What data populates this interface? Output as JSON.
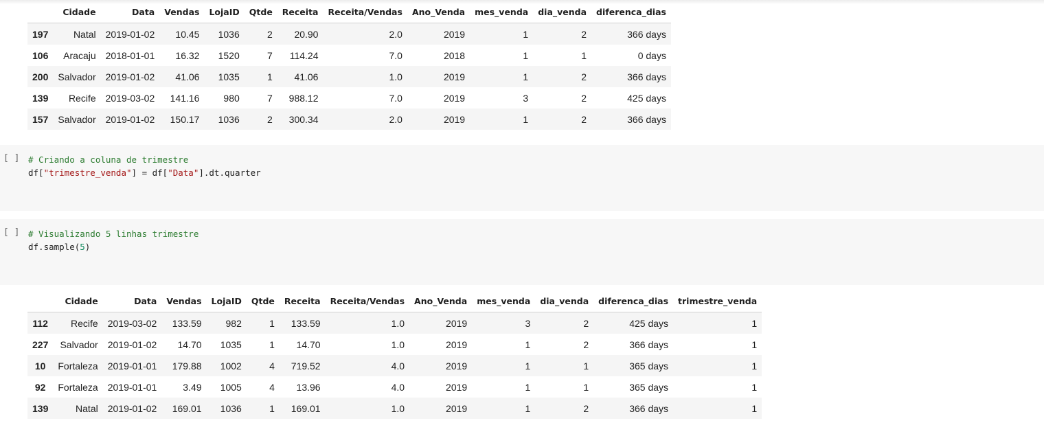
{
  "output1": {
    "columns": [
      "",
      "Cidade",
      "Data",
      "Vendas",
      "LojaID",
      "Qtde",
      "Receita",
      "Receita/Vendas",
      "Ano_Venda",
      "mes_venda",
      "dia_venda",
      "diferenca_dias"
    ],
    "rows": [
      [
        "197",
        "Natal",
        "2019-01-02",
        "10.45",
        "1036",
        "2",
        "20.90",
        "2.0",
        "2019",
        "1",
        "2",
        "366 days"
      ],
      [
        "106",
        "Aracaju",
        "2018-01-01",
        "16.32",
        "1520",
        "7",
        "114.24",
        "7.0",
        "2018",
        "1",
        "1",
        "0 days"
      ],
      [
        "200",
        "Salvador",
        "2019-01-02",
        "41.06",
        "1035",
        "1",
        "41.06",
        "1.0",
        "2019",
        "1",
        "2",
        "366 days"
      ],
      [
        "139",
        "Recife",
        "2019-03-02",
        "141.16",
        "980",
        "7",
        "988.12",
        "7.0",
        "2019",
        "3",
        "2",
        "425 days"
      ],
      [
        "157",
        "Salvador",
        "2019-01-02",
        "150.17",
        "1036",
        "2",
        "300.34",
        "2.0",
        "2019",
        "1",
        "2",
        "366 days"
      ]
    ]
  },
  "cell1": {
    "run_label": "[ ]",
    "comment": "# Criando a coluna de trimestre",
    "code_prefix": "df[",
    "code_str1": "\"trimestre_venda\"",
    "code_mid": "] = df[",
    "code_str2": "\"Data\"",
    "code_suffix": "].dt.quarter"
  },
  "cell2": {
    "run_label": "[ ]",
    "comment": "# Visualizando 5 linhas trimestre",
    "code_prefix": "df.sample(",
    "code_num": "5",
    "code_suffix": ")"
  },
  "output2": {
    "columns": [
      "",
      "Cidade",
      "Data",
      "Vendas",
      "LojaID",
      "Qtde",
      "Receita",
      "Receita/Vendas",
      "Ano_Venda",
      "mes_venda",
      "dia_venda",
      "diferenca_dias",
      "trimestre_venda"
    ],
    "rows": [
      [
        "112",
        "Recife",
        "2019-03-02",
        "133.59",
        "982",
        "1",
        "133.59",
        "1.0",
        "2019",
        "3",
        "2",
        "425 days",
        "1"
      ],
      [
        "227",
        "Salvador",
        "2019-01-02",
        "14.70",
        "1035",
        "1",
        "14.70",
        "1.0",
        "2019",
        "1",
        "2",
        "366 days",
        "1"
      ],
      [
        "10",
        "Fortaleza",
        "2019-01-01",
        "179.88",
        "1002",
        "4",
        "719.52",
        "4.0",
        "2019",
        "1",
        "1",
        "365 days",
        "1"
      ],
      [
        "92",
        "Fortaleza",
        "2019-01-01",
        "3.49",
        "1005",
        "4",
        "13.96",
        "4.0",
        "2019",
        "1",
        "1",
        "365 days",
        "1"
      ],
      [
        "139",
        "Natal",
        "2019-01-02",
        "169.01",
        "1036",
        "1",
        "169.01",
        "1.0",
        "2019",
        "1",
        "2",
        "366 days",
        "1"
      ]
    ]
  }
}
